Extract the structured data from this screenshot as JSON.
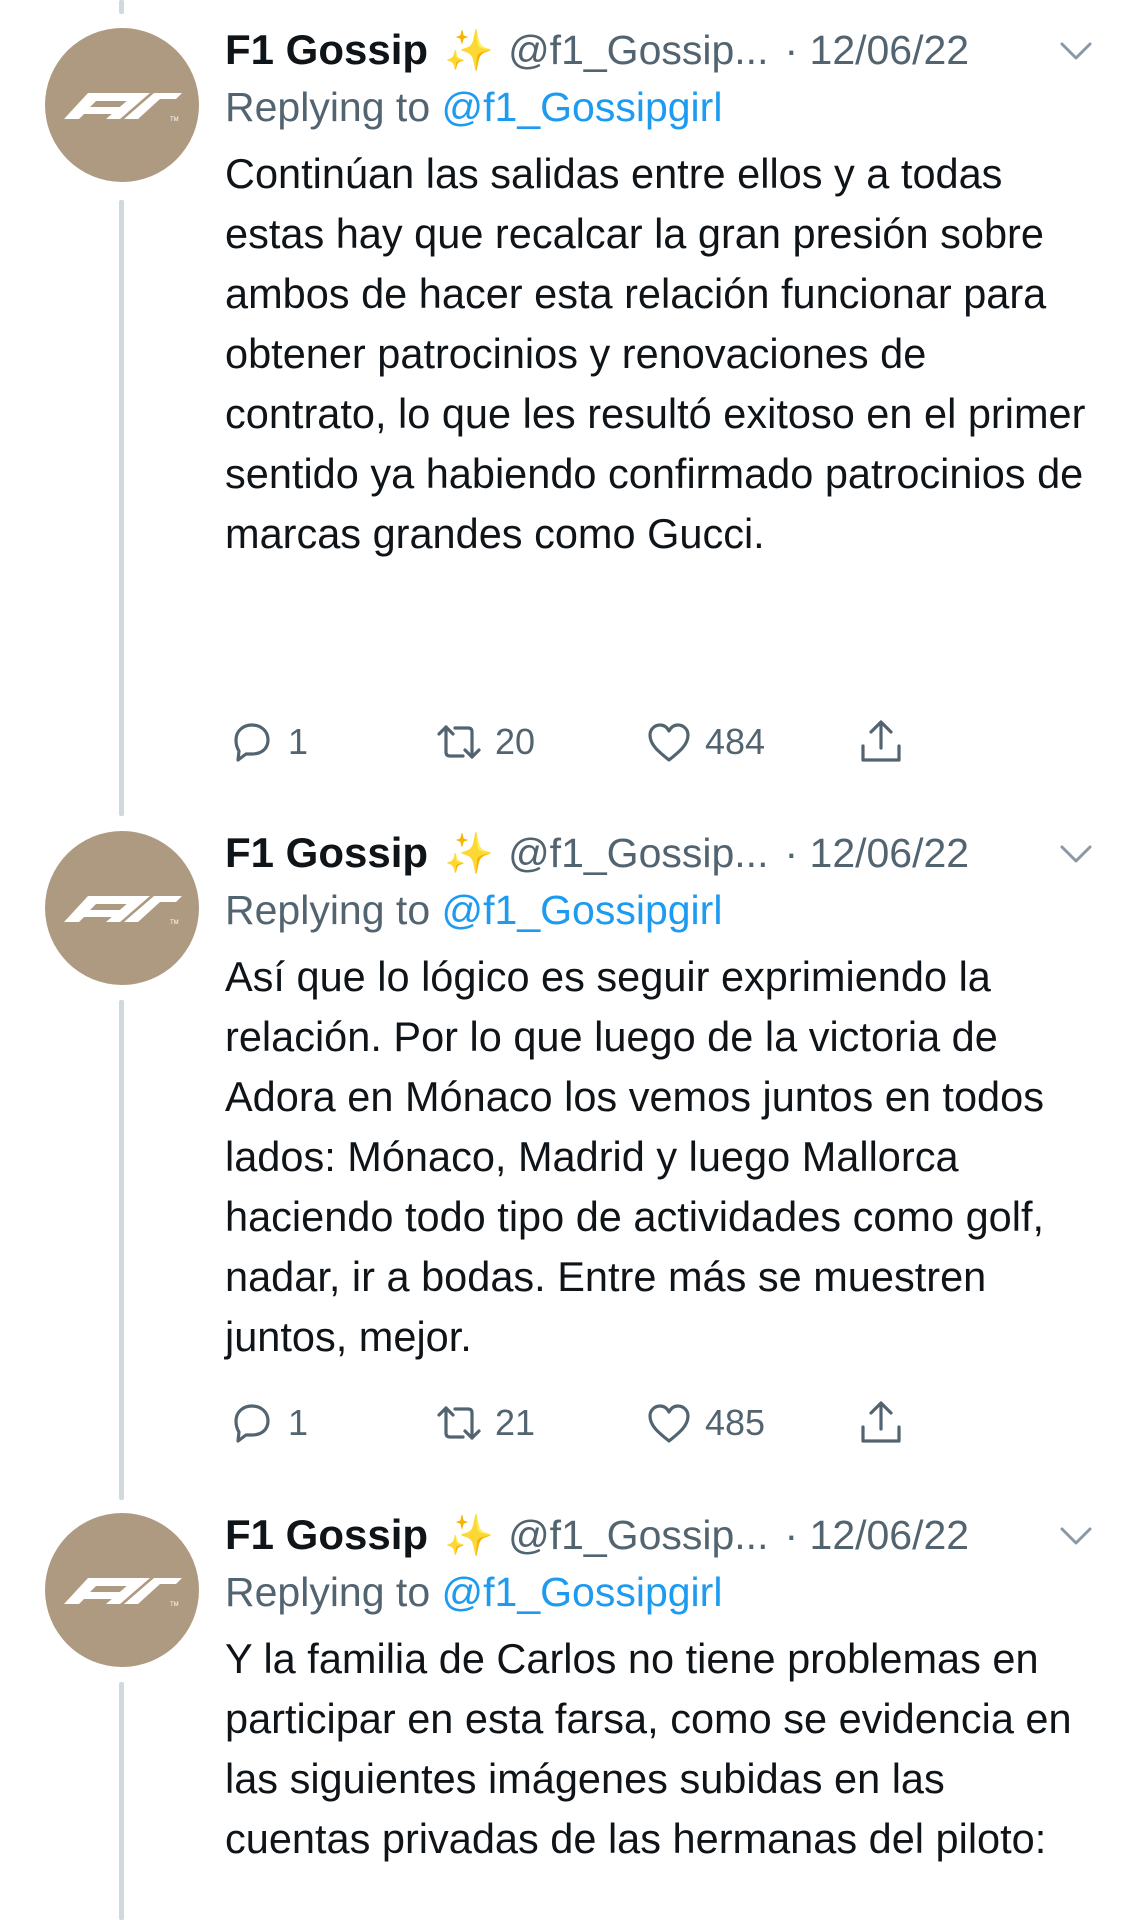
{
  "tweets": [
    {
      "display_name": "F1 Gossip",
      "sparkle": "✨",
      "handle": "@f1_Gossip...",
      "date": "· 12/06/22",
      "replying_prefix": "Replying to",
      "replying_to": "@f1_Gossipgirl",
      "text": "Continúan las salidas entre ellos y a todas estas hay que recalcar la gran presión sobre ambos de hacer esta relación funcionar para obtener patrocinios y renovaciones de contrato, lo que les resultó exitoso en el primer sentido ya habiendo confirmado patrocinios de marcas grandes como Gucci.",
      "replies": "1",
      "retweets": "20",
      "likes": "484"
    },
    {
      "display_name": "F1 Gossip",
      "sparkle": "✨",
      "handle": "@f1_Gossip...",
      "date": "· 12/06/22",
      "replying_prefix": "Replying to",
      "replying_to": "@f1_Gossipgirl",
      "text": "Así que lo lógico es seguir exprimiendo la relación. Por lo que luego de la victoria de Adora en Mónaco los vemos juntos en todos lados: Mónaco, Madrid y luego Mallorca haciendo todo tipo de actividades como golf, nadar, ir a bodas. Entre más se muestren juntos, mejor.",
      "replies": "1",
      "retweets": "21",
      "likes": "485"
    },
    {
      "display_name": "F1 Gossip",
      "sparkle": "✨",
      "handle": "@f1_Gossip...",
      "date": "· 12/06/22",
      "replying_prefix": "Replying to",
      "replying_to": "@f1_Gossipgirl",
      "text": "Y la familia de Carlos no tiene problemas en participar en esta farsa, como se evidencia en las siguientes imágenes subidas en las cuentas privadas de las hermanas del piloto:"
    }
  ],
  "icons": {
    "avatar": "f1-logo-icon",
    "reply": "reply-icon",
    "retweet": "retweet-icon",
    "like": "heart-icon",
    "share": "share-icon",
    "more": "chevron-down-icon"
  },
  "colors": {
    "avatar_bg": "#ad9a80",
    "link": "#1d9bf0",
    "secondary_text": "#536471",
    "thread_line": "#cfd9de"
  }
}
